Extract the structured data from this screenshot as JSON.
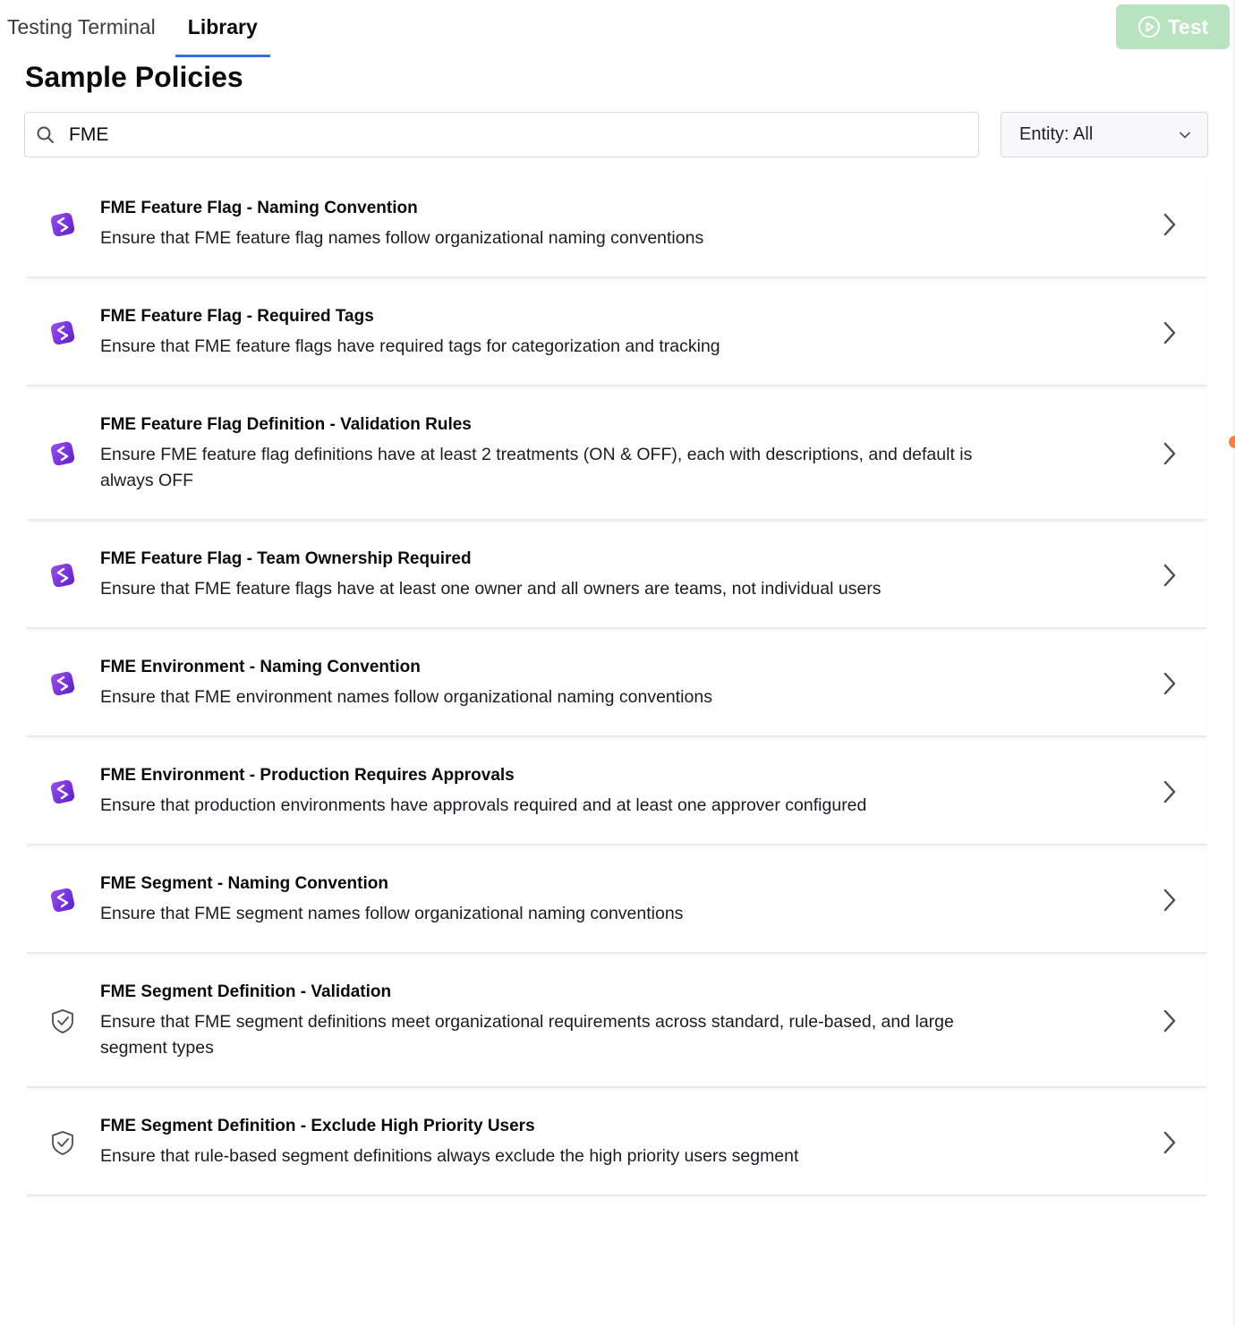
{
  "tabs": [
    {
      "label": "Testing Terminal",
      "active": false
    },
    {
      "label": "Library",
      "active": true
    }
  ],
  "test_button": {
    "label": "Test",
    "icon": "play-circle-icon",
    "color": "#b7e3bf"
  },
  "title": "Sample Policies",
  "search": {
    "value": "FME",
    "icon": "search-icon"
  },
  "entity_filter": {
    "label": "Entity: All",
    "icon": "chevron-down-icon"
  },
  "accent_color": "#3a6fd8",
  "policies": [
    {
      "name": "FME Feature Flag - Naming Convention",
      "description": "Ensure that FME feature flag names follow organizational naming conventions",
      "icon": "fme-logo-icon"
    },
    {
      "name": "FME Feature Flag - Required Tags",
      "description": "Ensure that FME feature flags have required tags for categorization and tracking",
      "icon": "fme-logo-icon"
    },
    {
      "name": "FME Feature Flag Definition - Validation Rules",
      "description": "Ensure FME feature flag definitions have at least 2 treatments (ON & OFF), each with descriptions, and default is always OFF",
      "icon": "fme-logo-icon"
    },
    {
      "name": "FME Feature Flag - Team Ownership Required",
      "description": "Ensure that FME feature flags have at least one owner and all owners are teams, not individual users",
      "icon": "fme-logo-icon"
    },
    {
      "name": "FME Environment - Naming Convention",
      "description": "Ensure that FME environment names follow organizational naming conventions",
      "icon": "fme-logo-icon"
    },
    {
      "name": "FME Environment - Production Requires Approvals",
      "description": "Ensure that production environments have approvals required and at least one approver configured",
      "icon": "fme-logo-icon"
    },
    {
      "name": "FME Segment - Naming Convention",
      "description": "Ensure that FME segment names follow organizational naming conventions",
      "icon": "fme-logo-icon"
    },
    {
      "name": "FME Segment Definition - Validation",
      "description": "Ensure that FME segment definitions meet organizational requirements across standard, rule-based, and large segment types",
      "icon": "shield-check-icon"
    },
    {
      "name": "FME Segment Definition - Exclude High Priority Users",
      "description": "Ensure that rule-based segment definitions always exclude the high priority users segment",
      "icon": "shield-check-icon"
    }
  ]
}
